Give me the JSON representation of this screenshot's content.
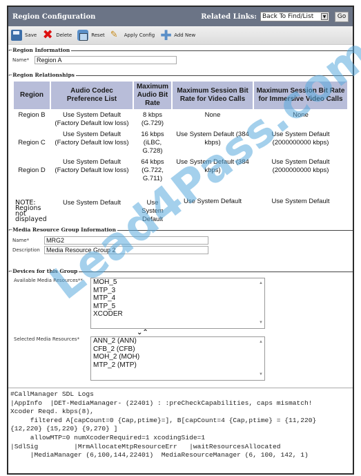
{
  "header": {
    "title": "Region Configuration",
    "related_links_label": "Related Links:",
    "related_links_value": "Back To Find/List",
    "go_label": "Go"
  },
  "toolbar": {
    "save": "Save",
    "delete": "Delete",
    "reset": "Reset",
    "apply_config": "Apply Config",
    "add_new": "Add New"
  },
  "region_information": {
    "legend": "Region Information",
    "name_label": "Name*",
    "name_value": "Region A"
  },
  "region_relationships": {
    "legend": "Region Relationships",
    "columns": [
      "Region",
      "Audio Codec Preference List",
      "Maximum Audio Bit Rate",
      "Maximum Session Bit Rate for Video Calls",
      "Maximum Session Bit Rate for Immersive Video Calls"
    ],
    "rows": [
      {
        "region": "Region B",
        "codec": "Use System Default (Factory Default low loss)",
        "audio": "8 kbps (G.729)",
        "video": "None",
        "immersive": "None"
      },
      {
        "region": "Region C",
        "codec": "Use System Default (Factory Default low loss)",
        "audio": "16 kbps (iLBC, G.728)",
        "video": "Use System Default (384 kbps)",
        "immersive": "Use System Default (2000000000 kbps)"
      },
      {
        "region": "Region D",
        "codec": "Use System Default (Factory Default low loss)",
        "audio": "64 kbps (G.722, G.711)",
        "video": "Use System Default (384 kbps)",
        "immersive": "Use System Default (2000000000 kbps)"
      },
      {
        "region": "NOTE: Regions not displayed",
        "codec": "Use System Default",
        "audio": "Use System Default",
        "video": "Use System Default",
        "immersive": "Use System Default"
      }
    ]
  },
  "mrg_information": {
    "legend": "Media Resource Group Information",
    "name_label": "Name*",
    "name_value": "MRG2",
    "description_label": "Description",
    "description_value": "Media Resource Group 2"
  },
  "devices": {
    "legend": "Devices for this Group",
    "available_label": "Available Media Resources**",
    "available": [
      "MOH_5",
      "MTP_3",
      "MTP_4",
      "MTP_5",
      "XCODER"
    ],
    "move_buttons": "⌄⌃",
    "selected_label": "Selected Media Resources*",
    "selected": [
      "ANN_2 (ANN)",
      "CFB_2 (CFB)",
      "MOH_2 (MOH)",
      "MTP_2 (MTP)"
    ]
  },
  "logs": {
    "lines": [
      "#CallManager SDL Logs",
      "|AppInfo  |DET-MediaManager- (22401) : :preCheckCapabilities, caps mismatch!",
      "Xcoder Reqd. kbps(8),",
      "     filtered A[capCount=0 {Cap,ptime}=], B[capCount=4 {Cap,ptime} = {11,220}",
      "{12,220} {15,220} {9,270} ]",
      "     allowMTP=0 numXcoderRequired=1 xcodingSide=1",
      "|SdlSig         |MrmAllocateMtpResourceErr   |waitResourcesAllocated",
      "     |MediaManager (6,100,144,22401)  MediaResourceManager (6, 100, 142, 1)"
    ]
  },
  "watermark": "Lead4Pass.com"
}
